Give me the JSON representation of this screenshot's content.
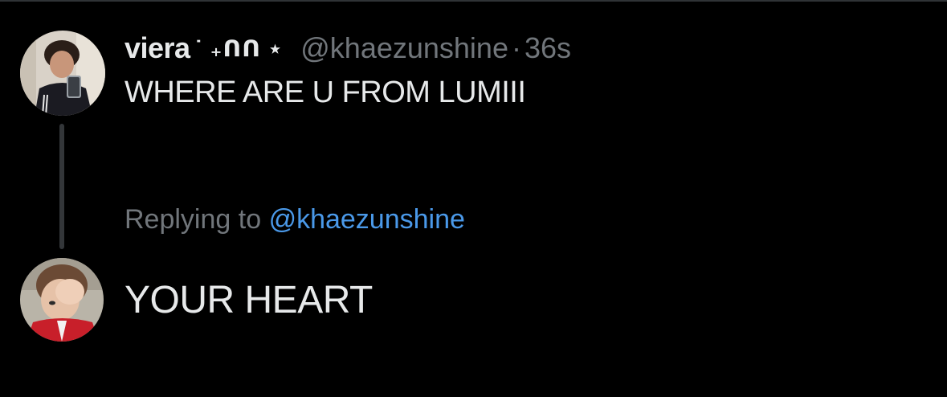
{
  "original_tweet": {
    "display_name": "viera",
    "name_decoration": "˙ ₊ᑎᑎ ⋆",
    "handle": "@khaezunshine",
    "separator": "·",
    "timestamp": "36s",
    "text": "WHERE ARE U FROM LUMIII"
  },
  "reply": {
    "replying_to_prefix": "Replying to",
    "replying_to_handle": "@khaezunshine",
    "text": "YOUR HEART"
  },
  "colors": {
    "background": "#000000",
    "primary_text": "#e7e9ea",
    "secondary_text": "#71767b",
    "mention": "#4a99e9",
    "thread_line": "#333639"
  },
  "icons": {
    "avatar_1": "user-avatar-mirror-selfie",
    "avatar_2": "user-avatar-hand-over-face"
  }
}
